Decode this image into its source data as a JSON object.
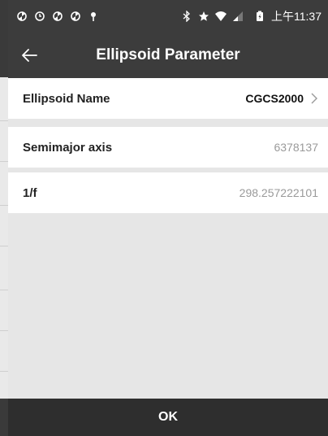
{
  "status_bar": {
    "time": "上午11:37",
    "icons": [
      "sync-icon",
      "alarm-icon",
      "sync-icon",
      "sync-icon",
      "location-pin-icon",
      "bluetooth-icon",
      "star-icon",
      "wifi-icon",
      "signal-icon",
      "battery-icon"
    ]
  },
  "app_bar": {
    "title": "Ellipsoid Parameter",
    "back_icon": "arrow-left-icon"
  },
  "rows": [
    {
      "label": "Ellipsoid Name",
      "value": "CGCS2000"
    },
    {
      "label": "Semimajor axis",
      "value": "6378137"
    },
    {
      "label": "1/f",
      "value": "298.257222101"
    }
  ],
  "ok_label": "OK",
  "colors": {
    "header_bg": "#3c3c3c",
    "footer_bg": "#2e2e2e",
    "content_bg": "#e6e6e6",
    "row_bg": "#ffffff",
    "muted_text": "#9a9a9a"
  }
}
